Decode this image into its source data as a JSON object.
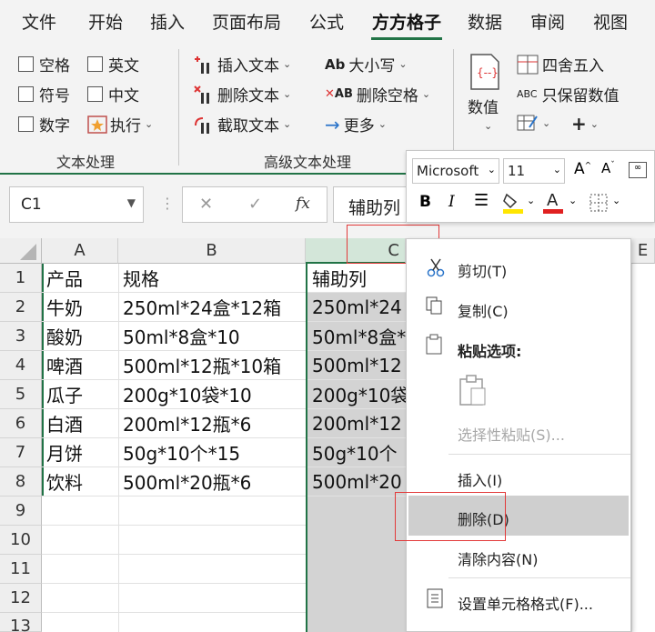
{
  "menubar": {
    "tabs": [
      "文件",
      "开始",
      "插入",
      "页面布局",
      "公式",
      "方方格子",
      "数据",
      "审阅",
      "视图"
    ],
    "active_tab": "方方格子"
  },
  "ribbon": {
    "text_group": {
      "checkboxes": [
        "空格",
        "英文",
        "符号",
        "中文",
        "数字"
      ],
      "execute": "执行",
      "label": "文本处理"
    },
    "advanced_group": {
      "insert_text": "插入文本",
      "delete_text": "删除文本",
      "extract_text": "截取文本",
      "case": "大小写",
      "delete_space": "删除空格",
      "more": "更多",
      "label": "高级文本处理"
    },
    "number_group": {
      "value_label": "数值",
      "round": "四舍五入",
      "keep_value_prefix": "ABC",
      "keep_value": "只保留数值",
      "plus": "+"
    }
  },
  "formula_bar": {
    "name_box": "C1",
    "cancel": "✕",
    "confirm": "✓",
    "fx": "fx",
    "value": "辅助列"
  },
  "mini_toolbar": {
    "font": "Microsoft",
    "size": "11",
    "bold": "B",
    "italic": "I"
  },
  "sheet": {
    "columns": [
      "A",
      "B",
      "C",
      "E"
    ],
    "rows": [
      "1",
      "2",
      "3",
      "4",
      "5",
      "6",
      "7",
      "8",
      "9",
      "10",
      "11",
      "12",
      "13"
    ],
    "data": [
      [
        "产品",
        "规格",
        "辅助列"
      ],
      [
        "牛奶",
        "250ml*24盒*12箱",
        "250ml*24"
      ],
      [
        "酸奶",
        "50ml*8盒*10",
        "50ml*8盒*"
      ],
      [
        "啤酒",
        "500ml*12瓶*10箱",
        "500ml*12"
      ],
      [
        "瓜子",
        "200g*10袋*10",
        "200g*10袋"
      ],
      [
        "白酒",
        "200ml*12瓶*6",
        "200ml*12"
      ],
      [
        "月饼",
        "50g*10个*15",
        "50g*10个"
      ],
      [
        "饮料",
        "500ml*20瓶*6",
        "500ml*20"
      ]
    ]
  },
  "context_menu": {
    "cut": "剪切(T)",
    "copy": "复制(C)",
    "paste_options": "粘贴选项:",
    "paste_special": "选择性粘贴(S)...",
    "insert": "插入(I)",
    "delete": "删除(D)",
    "clear": "清除内容(N)",
    "format_cells": "设置单元格格式(F)..."
  },
  "colors": {
    "accent": "#217346",
    "highlight": "#e23a3a",
    "selection": "#d3d3d3"
  }
}
